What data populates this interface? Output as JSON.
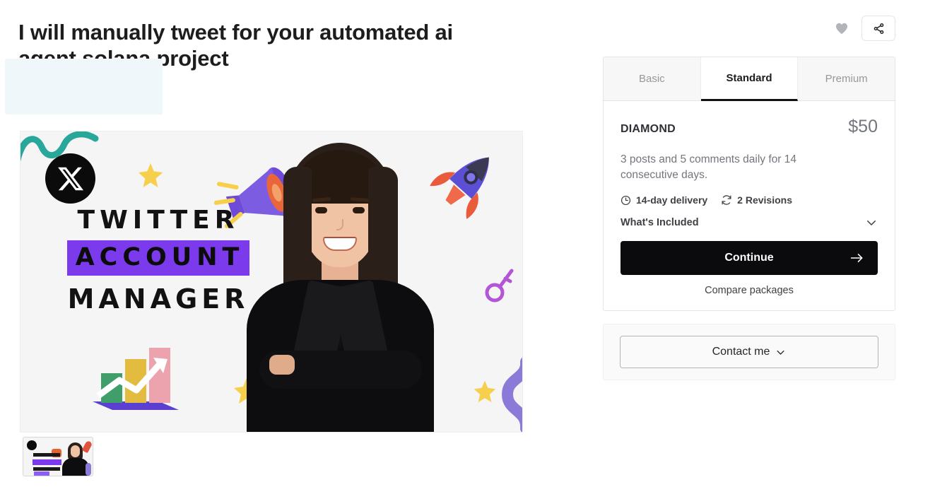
{
  "header": {
    "title": "I will manually tweet for your automated ai agent solana project",
    "favorite_icon": "heart-icon",
    "share_icon": "share-icon"
  },
  "gallery": {
    "main_image_alt": "Twitter Account Manager promotional graphic",
    "image_text": {
      "line1": "TWITTER",
      "line2": "ACCOUNT",
      "line3": "MANAGER"
    },
    "highlight_color": "#7c3aed",
    "icons": [
      "x-logo-icon",
      "megaphone-icon",
      "rocket-icon",
      "key-icon",
      "star-icon",
      "bar-chart-icon",
      "squiggle-icon"
    ],
    "thumbnails": [
      {
        "label": "Twitter Account Manager",
        "selected": true
      }
    ]
  },
  "package": {
    "tabs": [
      {
        "label": "Basic",
        "active": false
      },
      {
        "label": "Standard",
        "active": true
      },
      {
        "label": "Premium",
        "active": false
      }
    ],
    "name": "DIAMOND",
    "price": "$50",
    "description": "3 posts and 5 comments daily for 14 consecutive days.",
    "delivery": {
      "icon": "clock-icon",
      "label": "14-day delivery"
    },
    "revisions": {
      "icon": "refresh-icon",
      "label": "2 Revisions"
    },
    "whats_included": {
      "label": "What's Included",
      "icon": "chevron-down-icon",
      "expanded": false
    },
    "continue_label": "Continue",
    "continue_icon": "arrow-right-icon",
    "compare_label": "Compare packages",
    "accent_color": "#0b0b0d"
  },
  "contact": {
    "label": "Contact me",
    "icon": "chevron-down-icon"
  }
}
